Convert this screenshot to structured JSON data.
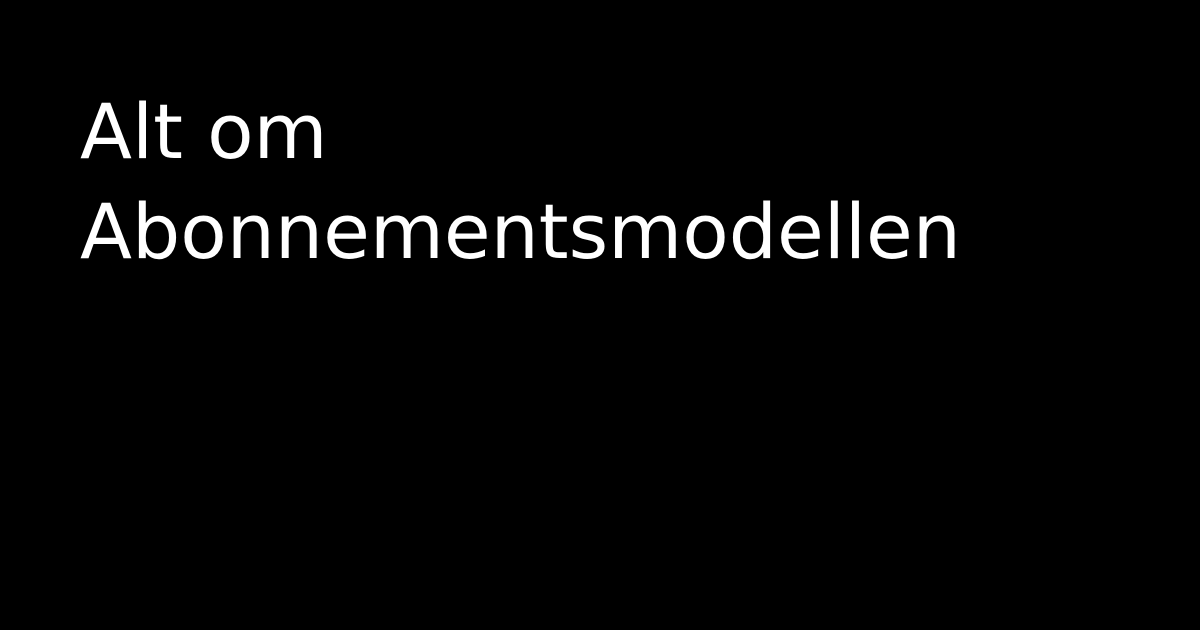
{
  "colors": {
    "background": "#000000",
    "text": "#ffffff"
  },
  "title": {
    "line1": "Alt om",
    "line2": "Abonnementsmodellen"
  }
}
